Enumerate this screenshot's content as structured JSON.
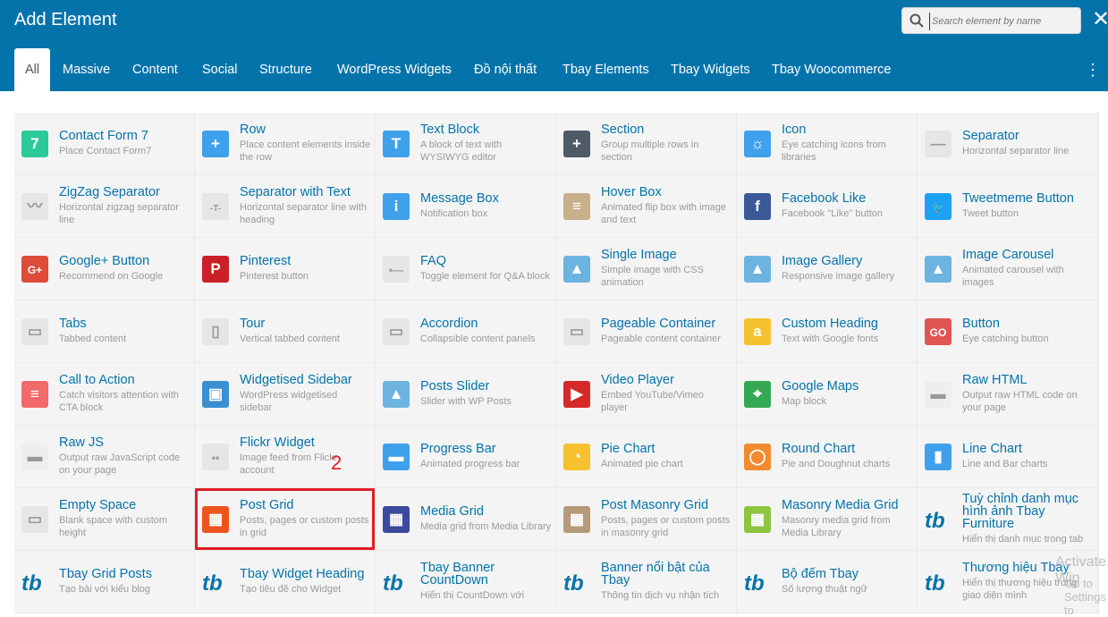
{
  "header": {
    "title": "Add Element",
    "search_placeholder": "Search element by name",
    "close_label": "✕",
    "more_label": "⋮"
  },
  "tabs": [
    "All",
    "Massive",
    "Content",
    "Social",
    "Structure",
    "WordPress Widgets",
    "Đồ nội thất",
    "Tbay Elements",
    "Tbay Widgets",
    "Tbay Woocommerce"
  ],
  "annotation": "2",
  "watermark": [
    "Activate Win",
    "Go to Settings to"
  ],
  "elements": [
    {
      "name": "Contact Form 7",
      "desc": "Place Contact Form7",
      "icon": "cf7-icon",
      "color": "#2bcb99",
      "glyph": "7"
    },
    {
      "name": "Row",
      "desc": "Place content elements inside the row",
      "icon": "row-icon",
      "color": "#3fa1eb",
      "glyph": "+"
    },
    {
      "name": "Text Block",
      "desc": "A block of text with WYSIWYG editor",
      "icon": "text-block-icon",
      "color": "#3fa1eb",
      "glyph": "T"
    },
    {
      "name": "Section",
      "desc": "Group multiple rows in section",
      "icon": "section-icon",
      "color": "#505a66",
      "glyph": "+"
    },
    {
      "name": "Icon",
      "desc": "Eye catching icons from libraries",
      "icon": "sun-icon",
      "color": "#3fa1eb",
      "glyph": "☼"
    },
    {
      "name": "Separator",
      "desc": "Horizontal separator line",
      "icon": "separator-icon",
      "color": "#e6e6e6",
      "glyph": "—"
    },
    {
      "name": "ZigZag Separator",
      "desc": "Horizontal zigzag separator line",
      "icon": "zigzag-icon",
      "color": "#e6e6e6",
      "glyph": "〰"
    },
    {
      "name": "Separator with Text",
      "desc": "Horizontal separator line with heading",
      "icon": "separator-text-icon",
      "color": "#e6e6e6",
      "glyph": "-T-"
    },
    {
      "name": "Message Box",
      "desc": "Notification box",
      "icon": "info-icon",
      "color": "#3fa1eb",
      "glyph": "i"
    },
    {
      "name": "Hover Box",
      "desc": "Animated flip box with image and text",
      "icon": "hover-box-icon",
      "color": "#c8b08a",
      "glyph": "≡"
    },
    {
      "name": "Facebook Like",
      "desc": "Facebook \"Like\" button",
      "icon": "facebook-icon",
      "color": "#3b5998",
      "glyph": "f"
    },
    {
      "name": "Tweetmeme Button",
      "desc": "Tweet button",
      "icon": "twitter-icon",
      "color": "#1da1f2",
      "glyph": "🐦"
    },
    {
      "name": "Google+ Button",
      "desc": "Recommend on Google",
      "icon": "google-plus-icon",
      "color": "#dd4b39",
      "glyph": "G+"
    },
    {
      "name": "Pinterest",
      "desc": "Pinterest button",
      "icon": "pinterest-icon",
      "color": "#cb2027",
      "glyph": "P"
    },
    {
      "name": "FAQ",
      "desc": "Toggle element for Q&A block",
      "icon": "faq-icon",
      "color": "#e6e6e6",
      "glyph": "•—"
    },
    {
      "name": "Single Image",
      "desc": "Simple image with CSS animation",
      "icon": "image-icon",
      "color": "#6db3e0",
      "glyph": "▲"
    },
    {
      "name": "Image Gallery",
      "desc": "Responsive image gallery",
      "icon": "gallery-icon",
      "color": "#6db3e0",
      "glyph": "▲"
    },
    {
      "name": "Image Carousel",
      "desc": "Animated carousel with images",
      "icon": "carousel-icon",
      "color": "#6db3e0",
      "glyph": "▲"
    },
    {
      "name": "Tabs",
      "desc": "Tabbed content",
      "icon": "tabs-icon",
      "color": "#e6e6e6",
      "glyph": "▭"
    },
    {
      "name": "Tour",
      "desc": "Vertical tabbed content",
      "icon": "tour-icon",
      "color": "#e6e6e6",
      "glyph": "▯"
    },
    {
      "name": "Accordion",
      "desc": "Collapsible content panels",
      "icon": "accordion-icon",
      "color": "#e6e6e6",
      "glyph": "▭"
    },
    {
      "name": "Pageable Container",
      "desc": "Pageable content container",
      "icon": "pageable-icon",
      "color": "#e6e6e6",
      "glyph": "▭"
    },
    {
      "name": "Custom Heading",
      "desc": "Text with Google fonts",
      "icon": "heading-icon",
      "color": "#f5c12e",
      "glyph": "a"
    },
    {
      "name": "Button",
      "desc": "Eye catching button",
      "icon": "go-button-icon",
      "color": "#e25454",
      "glyph": "GO"
    },
    {
      "name": "Call to Action",
      "desc": "Catch visitors attention with CTA block",
      "icon": "cta-icon",
      "color": "#f26a6a",
      "glyph": "≡"
    },
    {
      "name": "Widgetised Sidebar",
      "desc": "WordPress widgetised sidebar",
      "icon": "sidebar-icon",
      "color": "#3b8fd0",
      "glyph": "▣"
    },
    {
      "name": "Posts Slider",
      "desc": "Slider with WP Posts",
      "icon": "posts-slider-icon",
      "color": "#6db3e0",
      "glyph": "▲"
    },
    {
      "name": "Video Player",
      "desc": "Embed YouTube/Vimeo player",
      "icon": "video-icon",
      "color": "#d62a2a",
      "glyph": "▶"
    },
    {
      "name": "Google Maps",
      "desc": "Map block",
      "icon": "maps-icon",
      "color": "#34a853",
      "glyph": "⌖"
    },
    {
      "name": "Raw HTML",
      "desc": "Output raw HTML code on your page",
      "icon": "raw-html-icon",
      "color": "#eeeeee",
      "glyph": "▬"
    },
    {
      "name": "Raw JS",
      "desc": "Output raw JavaScript code on your page",
      "icon": "raw-js-icon",
      "color": "#eeeeee",
      "glyph": "▬"
    },
    {
      "name": "Flickr Widget",
      "desc": "Image feed from Flickr account",
      "icon": "flickr-icon",
      "color": "#e6e6e6",
      "glyph": "••"
    },
    {
      "name": "Progress Bar",
      "desc": "Animated progress bar",
      "icon": "progress-icon",
      "color": "#3fa1eb",
      "glyph": "▬"
    },
    {
      "name": "Pie Chart",
      "desc": "Animated pie chart",
      "icon": "pie-chart-icon",
      "color": "#f5c12e",
      "glyph": "◔"
    },
    {
      "name": "Round Chart",
      "desc": "Pie and Doughnut charts",
      "icon": "round-chart-icon",
      "color": "#f28b30",
      "glyph": "◯"
    },
    {
      "name": "Line Chart",
      "desc": "Line and Bar charts",
      "icon": "line-chart-icon",
      "color": "#3fa1eb",
      "glyph": "▮"
    },
    {
      "name": "Empty Space",
      "desc": "Blank space with custom height",
      "icon": "empty-space-icon",
      "color": "#e6e6e6",
      "glyph": "▭"
    },
    {
      "name": "Post Grid",
      "desc": "Posts, pages or custom posts in grid",
      "icon": "post-grid-icon",
      "color": "#f0541e",
      "glyph": "▦"
    },
    {
      "name": "Media Grid",
      "desc": "Media grid from Media Library",
      "icon": "media-grid-icon",
      "color": "#3a4a9c",
      "glyph": "▦"
    },
    {
      "name": "Post Masonry Grid",
      "desc": "Posts, pages or custom posts in masonry grid",
      "icon": "masonry-grid-icon",
      "color": "#b59a7a",
      "glyph": "▦"
    },
    {
      "name": "Masonry Media Grid",
      "desc": "Masonry media grid from Media Library",
      "icon": "masonry-media-icon",
      "color": "#8cc63f",
      "glyph": "▦"
    },
    {
      "name": "Tuỳ chỉnh danh mục hình ảnh Tbay Furniture",
      "desc": "Hiển thị danh mục trong tab",
      "icon": "tbay-logo-icon",
      "color": "transparent",
      "glyph": "tb"
    },
    {
      "name": "Tbay Grid Posts",
      "desc": "Tạo bài với kiểu blog",
      "icon": "tbay-logo-icon",
      "color": "transparent",
      "glyph": "tb"
    },
    {
      "name": "Tbay Widget Heading",
      "desc": "Tạo tiêu đề cho Widget",
      "icon": "tbay-logo-icon",
      "color": "transparent",
      "glyph": "tb"
    },
    {
      "name": "Tbay Banner CountDown",
      "desc": "Hiển thị CountDown với",
      "icon": "tbay-logo-icon",
      "color": "transparent",
      "glyph": "tb"
    },
    {
      "name": "Banner nổi bật của Tbay",
      "desc": "Thông tin dịch vụ nhận tích",
      "icon": "tbay-logo-icon",
      "color": "transparent",
      "glyph": "tb"
    },
    {
      "name": "Bộ đếm Tbay",
      "desc": "Số lượng thuật ngữ",
      "icon": "tbay-logo-icon",
      "color": "transparent",
      "glyph": "tb"
    },
    {
      "name": "Thương hiệu Tbay",
      "desc": "Hiển thị thương hiệu trong giao diện mình",
      "icon": "tbay-logo-icon",
      "color": "transparent",
      "glyph": "tb"
    }
  ]
}
